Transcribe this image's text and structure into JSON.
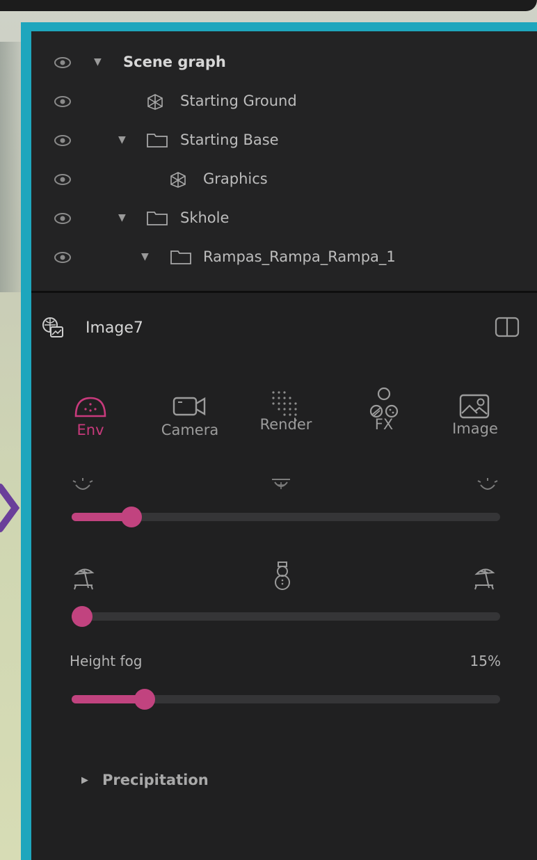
{
  "scene_graph": {
    "rows": [
      {
        "label": "Scene graph",
        "kind": "root"
      },
      {
        "label": "Starting Ground",
        "kind": "mesh"
      },
      {
        "label": "Starting Base",
        "kind": "folder"
      },
      {
        "label": "Graphics",
        "kind": "mesh"
      },
      {
        "label": "Skhole",
        "kind": "folder"
      },
      {
        "label": "Rampas_Rampa_Rampa_1",
        "kind": "folder"
      }
    ]
  },
  "panel": {
    "title": "Image7",
    "tabs": [
      {
        "label": "Env",
        "icon": "env-dome-icon",
        "active": true
      },
      {
        "label": "Camera",
        "icon": "camera-icon",
        "active": false
      },
      {
        "label": "Render",
        "icon": "render-dots-icon",
        "active": false
      },
      {
        "label": "FX",
        "icon": "fx-circles-icon",
        "active": false
      },
      {
        "label": "Image",
        "icon": "image-icon",
        "active": false
      }
    ],
    "time_slider": {
      "value": 0.14
    },
    "season_slider": {
      "value": 0.0
    },
    "height_fog": {
      "label": "Height fog",
      "value_text": "15%",
      "value": 0.17
    },
    "precipitation_label": "Precipitation"
  },
  "colors": {
    "accent": "#c1437f",
    "frame": "#1ea6bd",
    "panel_bg": "#202021",
    "track": "#353537"
  }
}
